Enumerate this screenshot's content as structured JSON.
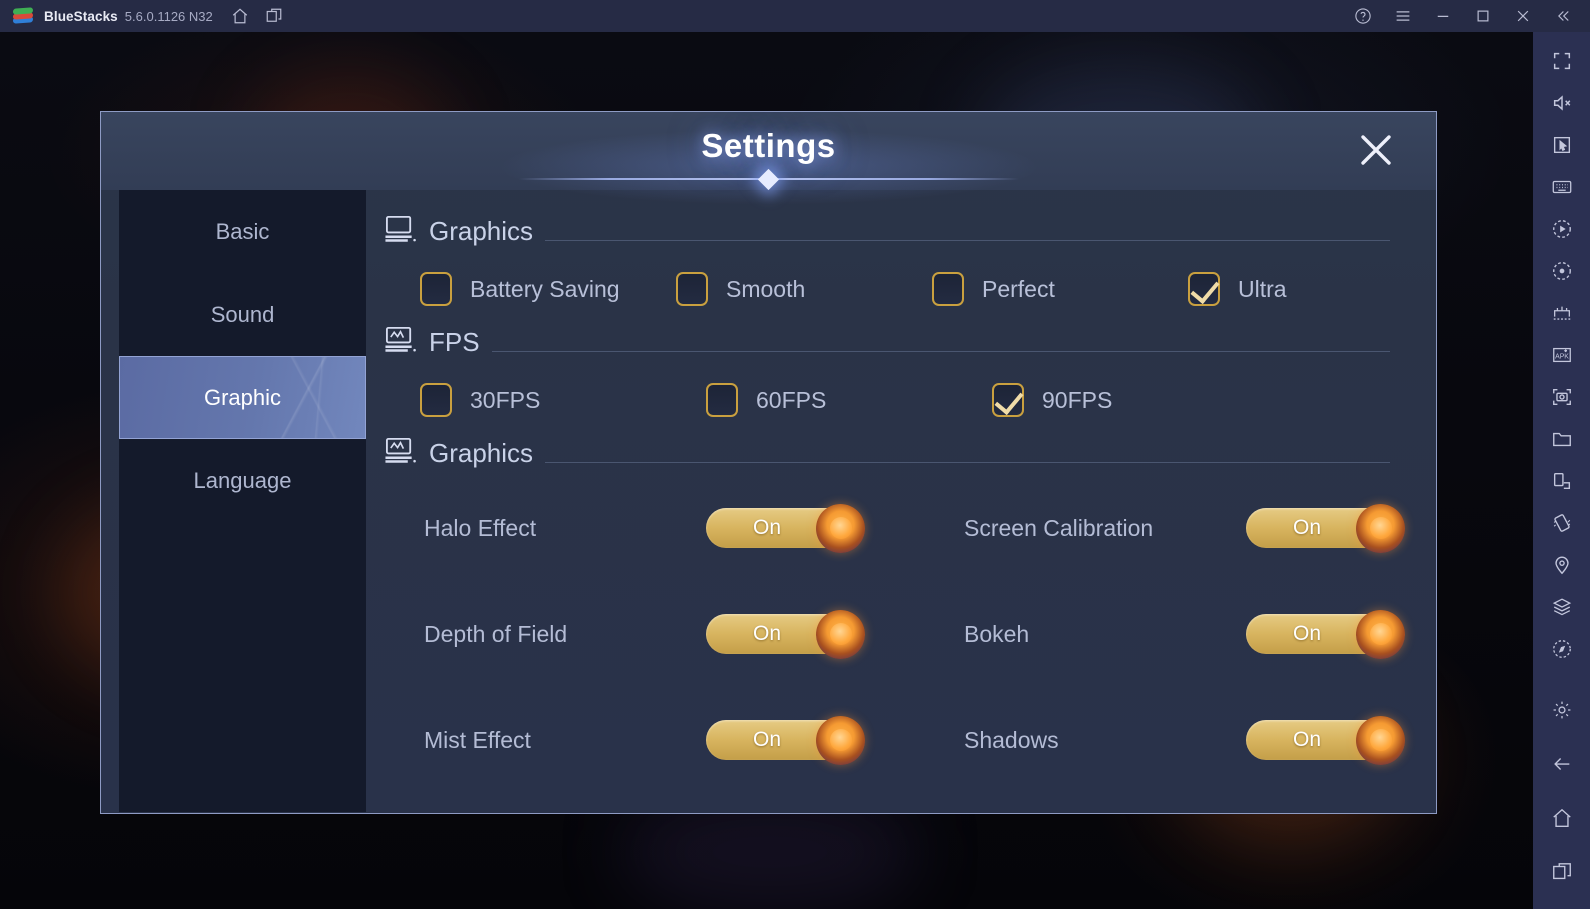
{
  "titlebar": {
    "app_name": "BlueStacks",
    "version": "5.6.0.1126 N32",
    "left_icons": [
      "home-icon",
      "multi-instance-icon"
    ],
    "right_icons": [
      "help-icon",
      "menu-icon",
      "minimize-icon",
      "maximize-icon",
      "close-icon",
      "collapse-icon"
    ]
  },
  "sidebar": {
    "icons": [
      "fullscreen-icon",
      "mute-icon",
      "cursor-icon",
      "keyboard-icon",
      "macro-icon",
      "record-icon",
      "game-controls-icon",
      "install-apk-icon",
      "screenshot-icon",
      "media-folder-icon",
      "rotate-icon",
      "shake-icon",
      "location-icon",
      "multi-instance-manager-icon",
      "compass-icon",
      "settings-icon",
      "back-icon",
      "home-nav-icon",
      "recents-icon"
    ]
  },
  "dialog": {
    "title": "Settings",
    "close_label": "close-icon",
    "tabs": [
      {
        "label": "Basic",
        "selected": false
      },
      {
        "label": "Sound",
        "selected": false
      },
      {
        "label": "Graphic",
        "selected": true
      },
      {
        "label": "Language",
        "selected": false
      }
    ],
    "sections": [
      {
        "title": "Graphics",
        "icon": "monitor-icon",
        "type": "checkboxes",
        "options": [
          {
            "label": "Battery Saving",
            "checked": false
          },
          {
            "label": "Smooth",
            "checked": false
          },
          {
            "label": "Perfect",
            "checked": false
          },
          {
            "label": "Ultra",
            "checked": true
          }
        ]
      },
      {
        "title": "FPS",
        "icon": "fps-monitor-icon",
        "type": "checkboxes",
        "options": [
          {
            "label": "30FPS",
            "checked": false
          },
          {
            "label": "60FPS",
            "checked": false
          },
          {
            "label": "90FPS",
            "checked": true
          }
        ]
      },
      {
        "title": "Graphics",
        "icon": "fps-monitor-icon",
        "type": "toggles",
        "rows": [
          [
            {
              "label": "Halo Effect",
              "state": "On"
            },
            {
              "label": "Screen Calibration",
              "state": "On"
            }
          ],
          [
            {
              "label": "Depth of Field",
              "state": "On"
            },
            {
              "label": "Bokeh",
              "state": "On"
            }
          ],
          [
            {
              "label": "Mist Effect",
              "state": "On"
            },
            {
              "label": "Shadows",
              "state": "On"
            }
          ]
        ]
      }
    ]
  },
  "colors": {
    "titlebar_bg": "#262b45",
    "sidebar_bg": "#2b3052",
    "dialog_bg": "#2a3347",
    "dialog_border": "#8e9bc4",
    "tab_selected": "#6477ad",
    "checkbox_gold": "#c9a03f",
    "toggle_gold": "#d8b560",
    "toggle_knob": "#f59a32",
    "text_primary": "#c9d2e8",
    "text_muted": "#b4bcd5"
  }
}
